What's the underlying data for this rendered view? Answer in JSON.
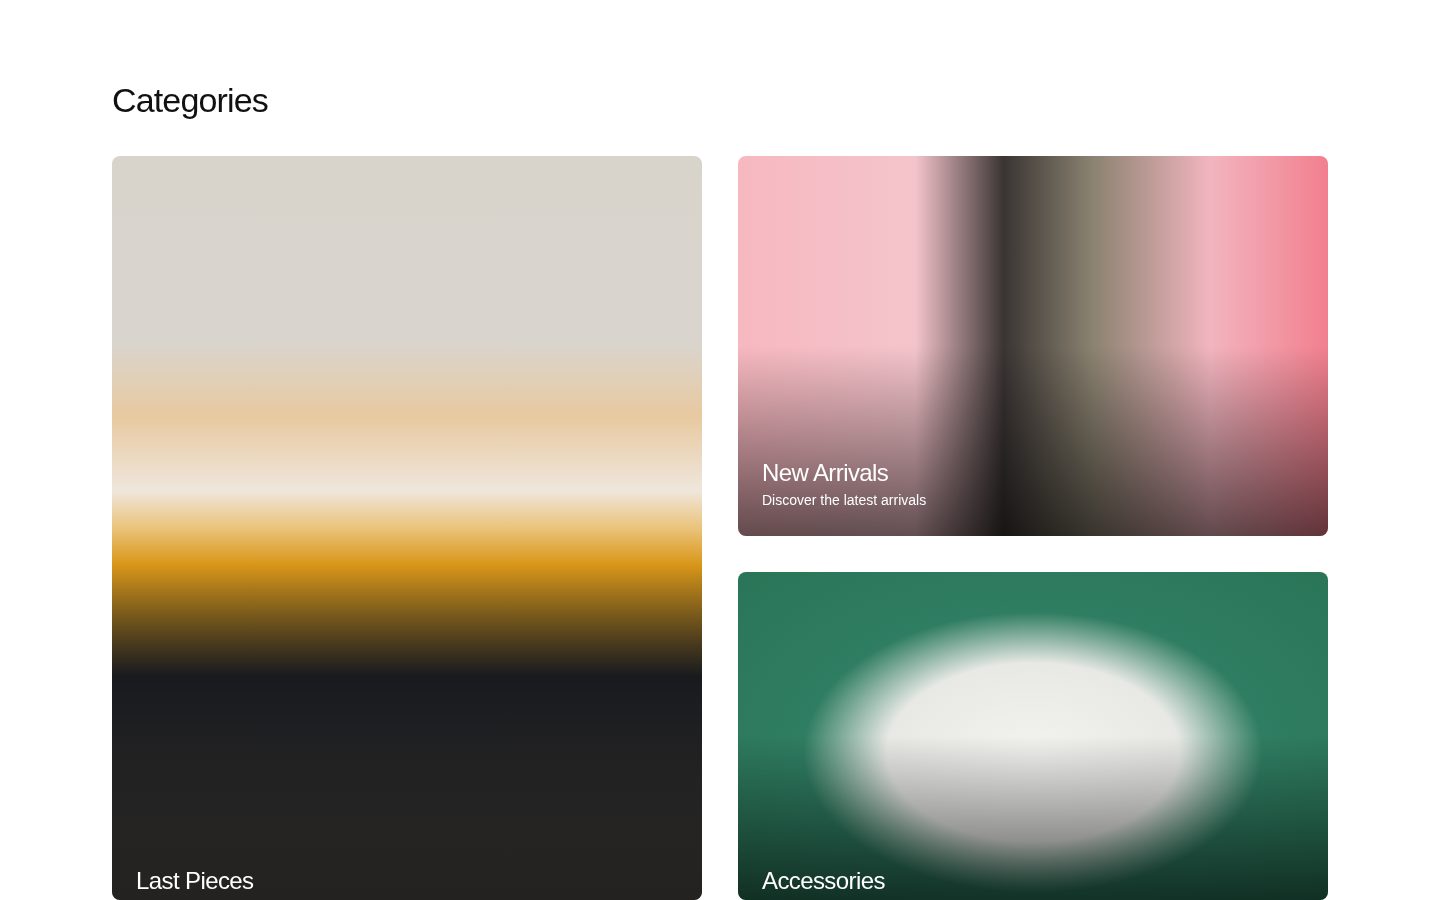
{
  "heading": "Categories",
  "categories": [
    {
      "title": "Last Pieces"
    },
    {
      "title": "New Arrivals",
      "subtitle": "Discover the latest arrivals"
    },
    {
      "title": "Accessories"
    }
  ]
}
